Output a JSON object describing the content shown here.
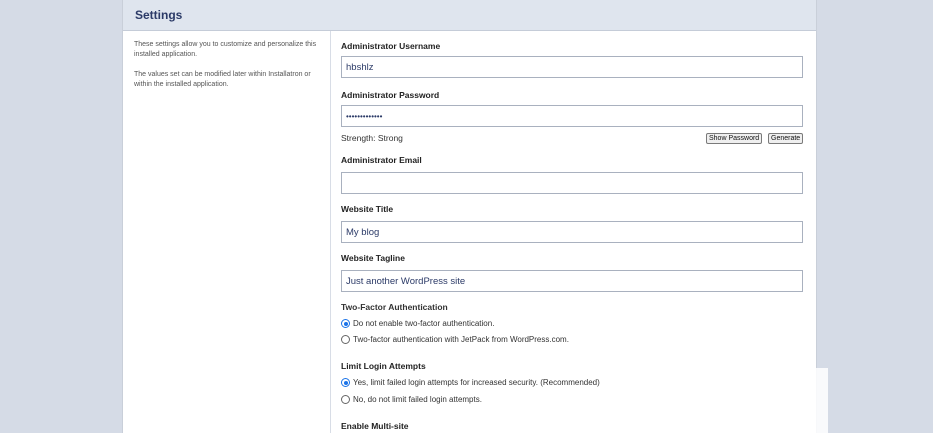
{
  "header": {
    "title": "Settings"
  },
  "sidebar": {
    "description_1": "These settings allow you to customize and personalize this installed application.",
    "description_2": "The values set can be modified later within Installatron or within the installed application."
  },
  "form": {
    "admin_username": {
      "label": "Administrator Username",
      "value": "hbshlz"
    },
    "admin_password": {
      "label": "Administrator Password",
      "value": "•••••••••••••",
      "strength": "Strength: Strong",
      "show_password_label": "Show Password",
      "generate_label": "Generate"
    },
    "admin_email": {
      "label": "Administrator Email",
      "value": ""
    },
    "website_title": {
      "label": "Website Title",
      "value": "My blog"
    },
    "website_tagline": {
      "label": "Website Tagline",
      "value": "Just another WordPress site"
    },
    "two_factor": {
      "label": "Two-Factor Authentication",
      "options": [
        "Do not enable two-factor authentication.",
        "Two-factor authentication with JetPack from WordPress.com."
      ],
      "selected_index": 0
    },
    "limit_login": {
      "label": "Limit Login Attempts",
      "options": [
        "Yes, limit failed login attempts for increased security. (Recommended)",
        "No, do not limit failed login attempts."
      ],
      "selected_index": 0
    },
    "multisite": {
      "label": "Enable Multi-site"
    }
  },
  "colors": {
    "accent": "#1a73e8",
    "header_text": "#2b3a67",
    "background": "#d5dbe6"
  }
}
